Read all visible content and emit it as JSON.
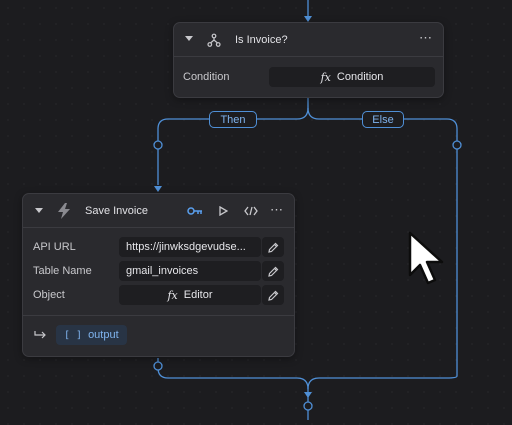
{
  "colors": {
    "canvas": "#1c1c1f",
    "node_bg": "#2a2a2e",
    "node_border": "#3b3b40",
    "field_bg": "#1e1e21",
    "accent": "#4f8fd6",
    "accent_text": "#7fb3ee"
  },
  "branches": {
    "then_label": "Then",
    "else_label": "Else"
  },
  "condition_node": {
    "title": "Is Invoice?",
    "icon": "branch-icon",
    "condition_label": "Condition",
    "condition_value": "Condition"
  },
  "save_node": {
    "title": "Save Invoice",
    "icon": "lightning-icon",
    "actions": [
      "key-icon",
      "play-icon",
      "code-icon",
      "more-icon"
    ],
    "fields": [
      {
        "label": "API URL",
        "value": "https://jinwksdgevudse..."
      },
      {
        "label": "Table Name",
        "value": "gmail_invoices"
      },
      {
        "label": "Object",
        "value": "Editor"
      }
    ],
    "output_label": "output"
  }
}
